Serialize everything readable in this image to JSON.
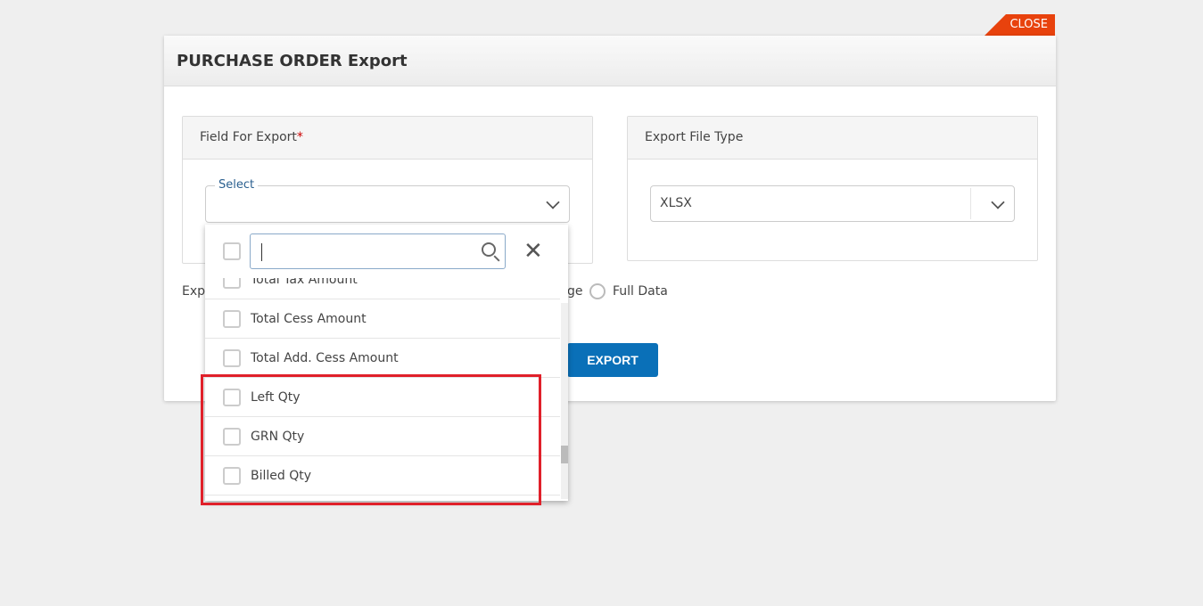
{
  "close_label": "CLOSE",
  "title": "PURCHASE ORDER Export",
  "field_panel": {
    "title": "Field For Export",
    "required_mark": "*",
    "select_label": "Select"
  },
  "file_panel": {
    "title": "Export File Type",
    "value": "XLSX"
  },
  "export_label_partial": "Exp",
  "option_partial": "ge",
  "full_data_label": "Full Data",
  "export_button": "EXPORT",
  "dropdown": {
    "search_value": "",
    "items": [
      {
        "label": "Total Tax Amount",
        "checked": false
      },
      {
        "label": "Total Cess Amount",
        "checked": false
      },
      {
        "label": "Total Add. Cess Amount",
        "checked": false
      },
      {
        "label": "Left Qty",
        "checked": false
      },
      {
        "label": "GRN Qty",
        "checked": false
      },
      {
        "label": "Billed Qty",
        "checked": false
      }
    ]
  },
  "colors": {
    "accent": "#0a70b8",
    "close": "#e8420d",
    "highlight": "#e0202a"
  }
}
